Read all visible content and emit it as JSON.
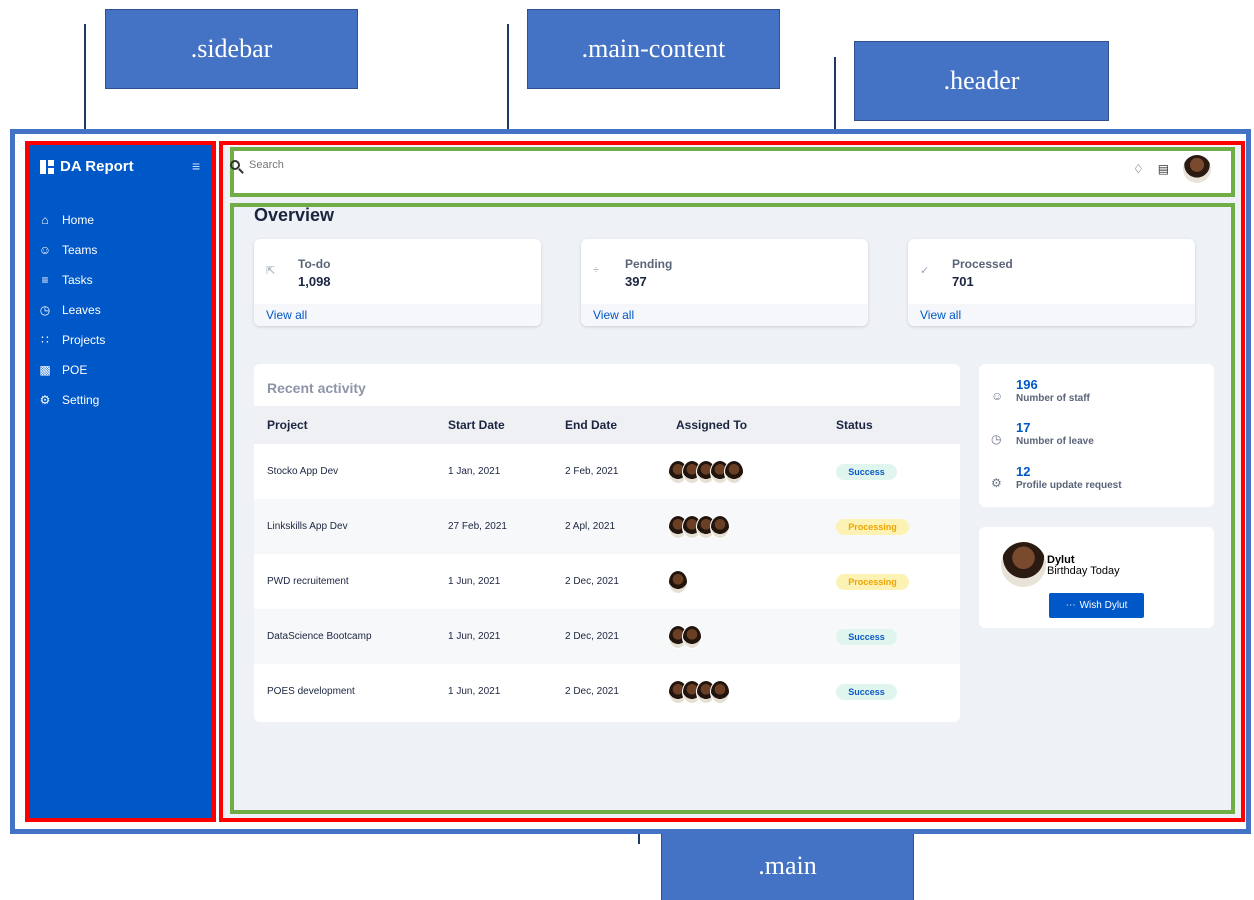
{
  "annotations": {
    "sidebar": ".sidebar",
    "main_content": ".main-content",
    "header": ".header",
    "main": ".main"
  },
  "brand": {
    "title": "DA Report",
    "menu_icon": "menu-icon"
  },
  "nav": [
    {
      "label": "Home",
      "icon": "home-icon"
    },
    {
      "label": "Teams",
      "icon": "smile-icon"
    },
    {
      "label": "Tasks",
      "icon": "tasks-icon"
    },
    {
      "label": "Leaves",
      "icon": "clock-icon"
    },
    {
      "label": "Projects",
      "icon": "grid-icon"
    },
    {
      "label": "POE",
      "icon": "bar-chart-icon"
    },
    {
      "label": "Setting",
      "icon": "gear-icon"
    }
  ],
  "header": {
    "search_placeholder": "Search"
  },
  "overview": {
    "title": "Overview",
    "cards": [
      {
        "label": "To-do",
        "value": "1,098",
        "link": "View all"
      },
      {
        "label": "Pending",
        "value": "397",
        "link": "View all"
      },
      {
        "label": "Processed",
        "value": "701",
        "link": "View all"
      }
    ]
  },
  "activity": {
    "title": "Recent activity",
    "columns": [
      "Project",
      "Start Date",
      "End Date",
      "Assigned To",
      "Status"
    ],
    "rows": [
      {
        "project": "Stocko App Dev",
        "start": "1 Jan, 2021",
        "end": "2 Feb, 2021",
        "assignees": 5,
        "status": "Success"
      },
      {
        "project": "Linkskills App Dev",
        "start": "27 Feb, 2021",
        "end": "2 Apl, 2021",
        "assignees": 4,
        "status": "Processing"
      },
      {
        "project": "PWD recruitement",
        "start": "1 Jun, 2021",
        "end": "2 Dec, 2021",
        "assignees": 1,
        "status": "Processing"
      },
      {
        "project": "DataScience Bootcamp",
        "start": "1 Jun, 2021",
        "end": "2 Dec, 2021",
        "assignees": 2,
        "status": "Success"
      },
      {
        "project": "POES development",
        "start": "1 Jun, 2021",
        "end": "2 Dec, 2021",
        "assignees": 4,
        "status": "Success"
      }
    ]
  },
  "stats": [
    {
      "value": "196",
      "label": "Number of staff",
      "icon": "smile-icon"
    },
    {
      "value": "17",
      "label": "Number of leave",
      "icon": "clock-icon"
    },
    {
      "value": "12",
      "label": "Profile update request",
      "icon": "gear-icon"
    }
  ],
  "birthday": {
    "name": "Dylut",
    "subtitle": "Birthday Today",
    "button": "Wish Dylut"
  },
  "colors": {
    "sidebar": "#0057c7",
    "accent": "#0057c7",
    "annotation": "#4472c4",
    "outline_red": "#ff0000",
    "outline_green": "#70ad47"
  }
}
